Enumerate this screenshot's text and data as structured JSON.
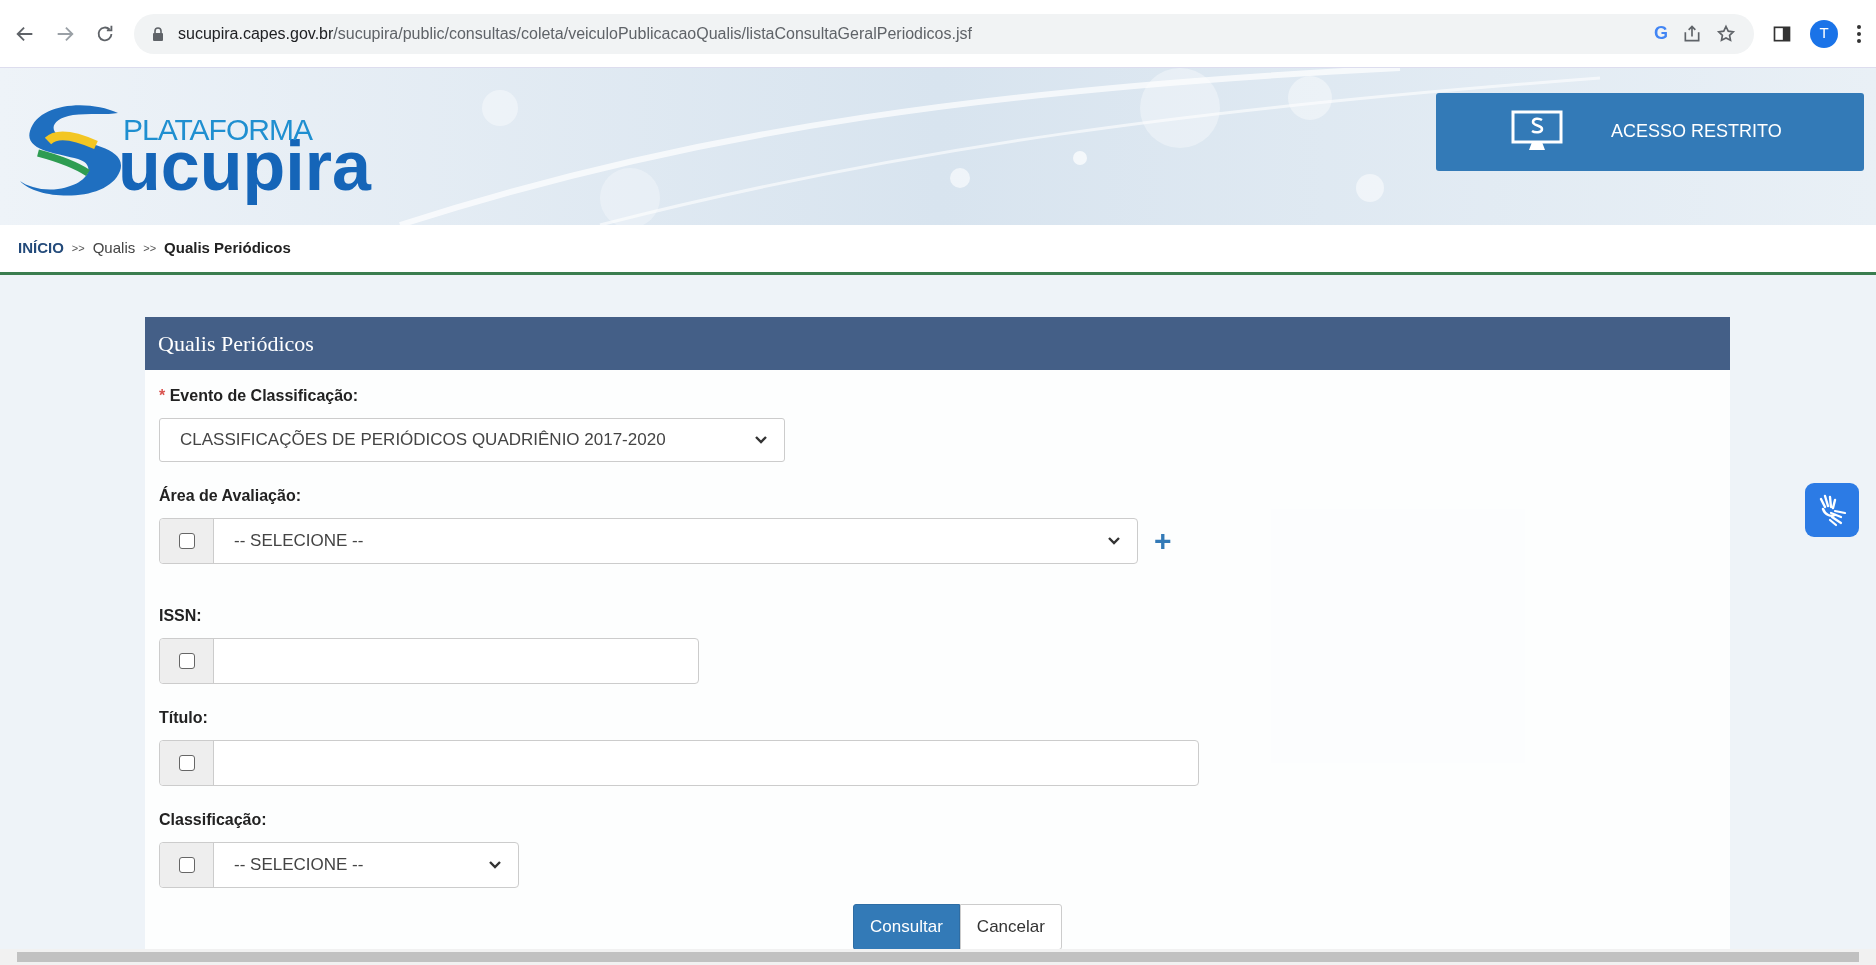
{
  "browser": {
    "url_host": "sucupira.capes.gov.br",
    "url_path": "/sucupira/public/consultas/coleta/veiculoPublicacaoQualis/listaConsultaGeralPeriodicos.jsf",
    "profile_initial": "T",
    "google_letter": "G"
  },
  "header": {
    "logo_small": "PLATAFORMA",
    "logo_large": "ucupira",
    "restricted_button": "ACESSO RESTRITO"
  },
  "breadcrumb": {
    "separator": ">>",
    "items": [
      {
        "label": "INÍCIO",
        "kind": "link"
      },
      {
        "label": "Qualis",
        "kind": "plain"
      },
      {
        "label": "Qualis Periódicos",
        "kind": "current"
      }
    ]
  },
  "panel": {
    "title": "Qualis Periódicos",
    "fields": [
      {
        "kind": "select",
        "label": "Evento de Classificação:",
        "required_mark": "*",
        "value": "CLASSIFICAÇÕES DE PERIÓDICOS QUADRIÊNIO 2017-2020"
      },
      {
        "kind": "check-select",
        "label": "Área de Avaliação:",
        "value": "-- SELECIONE --",
        "checked": false,
        "add_symbol": "+"
      },
      {
        "kind": "check-input",
        "label": "ISSN:",
        "checked": false
      },
      {
        "kind": "check-input",
        "label": "Título:",
        "checked": false
      },
      {
        "kind": "check-select",
        "label": "Classificação:",
        "value": "-- SELECIONE --",
        "checked": false
      }
    ],
    "buttons": [
      {
        "label": "Consultar",
        "primary": true
      },
      {
        "label": "Cancelar",
        "primary": false
      }
    ]
  }
}
